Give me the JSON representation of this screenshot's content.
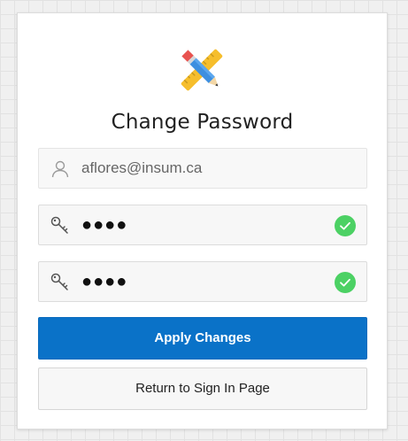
{
  "page": {
    "title": "Change Password"
  },
  "form": {
    "username_value": "aflores@insum.ca",
    "password_mask": "●●●●",
    "confirm_password_mask": "●●●●"
  },
  "buttons": {
    "apply_label": "Apply Changes",
    "return_label": "Return to Sign In Page"
  },
  "icons": {
    "logo": "ruler-pencil-icon",
    "username": "user-icon",
    "password": "key-icon",
    "valid": "check-circle-icon"
  },
  "colors": {
    "primary": "#0a72c8",
    "valid": "#4cd164"
  }
}
